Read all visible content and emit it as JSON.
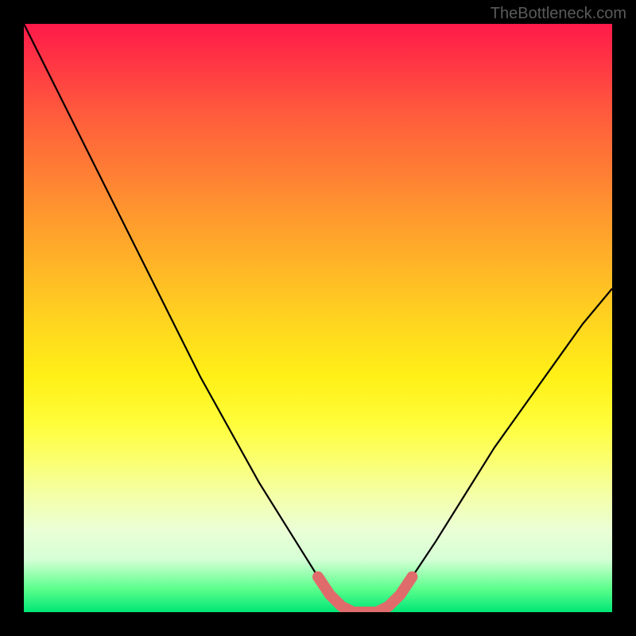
{
  "watermark": "TheBottleneck.com",
  "chart_data": {
    "type": "line",
    "title": "",
    "xlabel": "",
    "ylabel": "",
    "xlim": [
      0,
      100
    ],
    "ylim": [
      0,
      100
    ],
    "series": [
      {
        "name": "bottleneck-curve",
        "x": [
          0,
          5,
          10,
          15,
          20,
          25,
          30,
          35,
          40,
          45,
          50,
          52,
          54,
          56,
          58,
          60,
          62,
          64,
          66,
          70,
          75,
          80,
          85,
          90,
          95,
          100
        ],
        "values": [
          100,
          90,
          80,
          70,
          60,
          50,
          40,
          31,
          22,
          14,
          6,
          3,
          1,
          0,
          0,
          0,
          1,
          3,
          6,
          12,
          20,
          28,
          35,
          42,
          49,
          55
        ]
      },
      {
        "name": "bottleneck-highlight",
        "x": [
          50,
          52,
          54,
          56,
          58,
          60,
          62,
          64,
          66
        ],
        "values": [
          6,
          3,
          1,
          0,
          0,
          0,
          1,
          3,
          6
        ]
      }
    ],
    "colors": {
      "curve": "#000000",
      "highlight": "#e06b6b"
    }
  }
}
